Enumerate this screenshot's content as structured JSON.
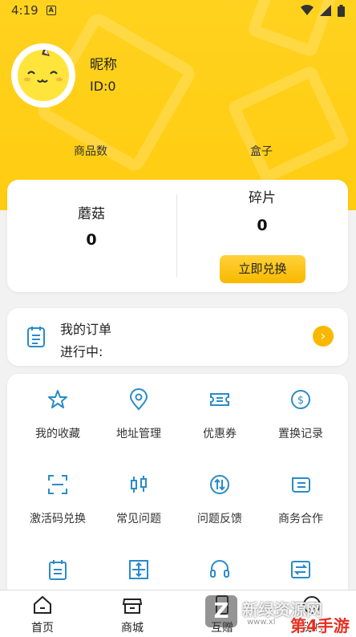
{
  "status_bar": {
    "time": "4:19"
  },
  "profile": {
    "nickname": "昵称",
    "id_text": "ID:0"
  },
  "stats": {
    "goods_label": "商品数",
    "box_label": "盒子"
  },
  "wallet": {
    "mushroom_label": "蘑菇",
    "mushroom_value": "0",
    "fragment_label": "碎片",
    "fragment_value": "0",
    "exchange_label": "立即兑换"
  },
  "order": {
    "title": "我的订单",
    "status": "进行中:"
  },
  "grid": {
    "items": [
      {
        "label": "我的收藏",
        "icon": "star-icon"
      },
      {
        "label": "地址管理",
        "icon": "location-icon"
      },
      {
        "label": "优惠券",
        "icon": "coupon-icon"
      },
      {
        "label": "置换记录",
        "icon": "dollar-icon"
      },
      {
        "label": "激活码兑换",
        "icon": "scan-icon"
      },
      {
        "label": "常见问题",
        "icon": "candlestick-icon"
      },
      {
        "label": "问题反馈",
        "icon": "exchange-circle-icon"
      },
      {
        "label": "商务合作",
        "icon": "card-icon"
      },
      {
        "label": "",
        "icon": "calendar-icon"
      },
      {
        "label": "",
        "icon": "expand-icon"
      },
      {
        "label": "",
        "icon": "headset-icon"
      },
      {
        "label": "",
        "icon": "swap-icon"
      }
    ]
  },
  "tabbar": {
    "home": "首页",
    "store": "商城",
    "gift": "互赠",
    "mine": "我的"
  },
  "watermark": {
    "site": "新绿资源网",
    "brand": "第4手游",
    "url": "www.xl"
  },
  "colors": {
    "accent": "#ffcc10",
    "icon": "#2a8bc8",
    "button": "#f8b800"
  }
}
